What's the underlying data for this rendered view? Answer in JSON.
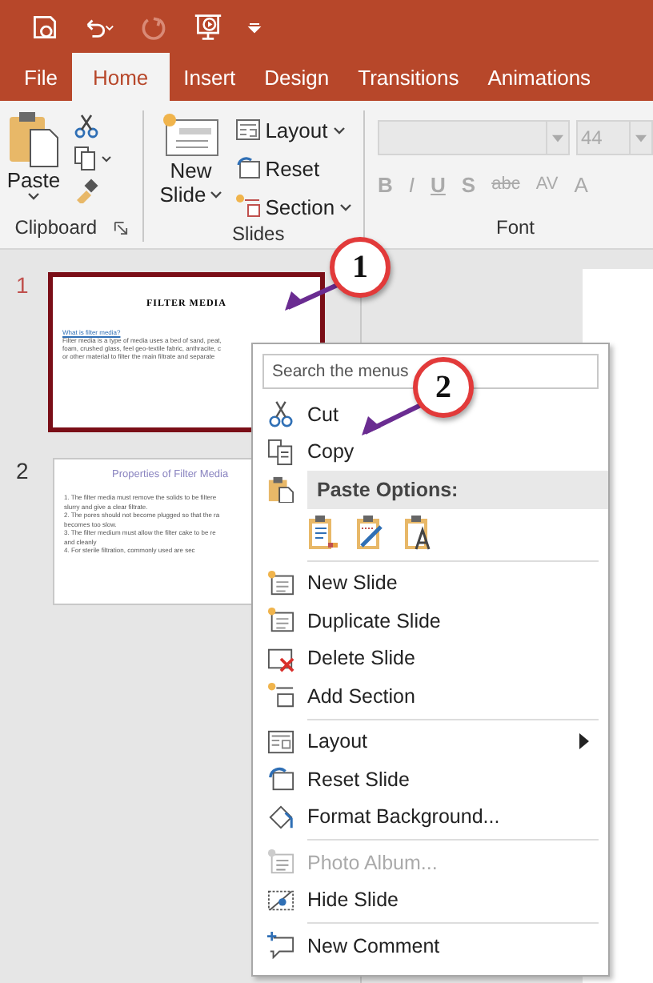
{
  "tabs": [
    {
      "label": "File",
      "selected": false
    },
    {
      "label": "Home",
      "selected": true
    },
    {
      "label": "Insert",
      "selected": false
    },
    {
      "label": "Design",
      "selected": false
    },
    {
      "label": "Transitions",
      "selected": false
    },
    {
      "label": "Animations",
      "selected": false
    }
  ],
  "ribbon": {
    "clipboard": {
      "paste": "Paste",
      "label": "Clipboard"
    },
    "slides": {
      "new_slide": [
        "New",
        "Slide"
      ],
      "layout": "Layout",
      "reset": "Reset",
      "section": "Section",
      "label": "Slides"
    },
    "font": {
      "size": "44",
      "disabled": true,
      "buttons": [
        "B",
        "I",
        "U",
        "S",
        "abc",
        "AV",
        "A"
      ],
      "label": "Font"
    }
  },
  "slides": [
    {
      "number": "1",
      "selected": true,
      "kind": "title",
      "title": "FILTER MEDIA",
      "link": "What is filter media?",
      "lines": [
        "Filter media is a type of media uses a bed of sand, peat,",
        "foam, crushed glass, feel geo-textile fabric, anthracite, c",
        "or other material to filter the main filtrate and separate"
      ]
    },
    {
      "number": "2",
      "selected": false,
      "kind": "list",
      "title": "Properties of Filter Media",
      "lines": [
        "1.  The filter media must remove the solids to be filtere",
        "     slurry and give a clear filtrate.",
        "2.  The pores should not become plugged so that the ra",
        "     becomes too slow.",
        "3.  The filter medium must allow the filter cake to be re",
        "     and cleanly",
        "4.  For sterile filtration, commonly used are sec"
      ]
    }
  ],
  "context_menu": {
    "search": {
      "placeholder": "Search the menus"
    },
    "items": [
      {
        "kind": "item",
        "label": "Cut",
        "disabled": false,
        "submenu": false,
        "separator_before": false
      },
      {
        "kind": "item",
        "label": "Copy",
        "disabled": false,
        "submenu": false,
        "separator_before": false
      },
      {
        "kind": "header",
        "label": "Paste Options:",
        "separator_before": false
      },
      {
        "kind": "paste_icons",
        "separator_before": false
      },
      {
        "kind": "item",
        "label": "New Slide",
        "disabled": false,
        "submenu": false,
        "separator_before": true
      },
      {
        "kind": "item",
        "label": "Duplicate Slide",
        "disabled": false,
        "submenu": false,
        "separator_before": false
      },
      {
        "kind": "item",
        "label": "Delete Slide",
        "disabled": false,
        "submenu": false,
        "separator_before": false
      },
      {
        "kind": "item",
        "label": "Add Section",
        "disabled": false,
        "submenu": false,
        "separator_before": false
      },
      {
        "kind": "item",
        "label": "Layout",
        "disabled": false,
        "submenu": true,
        "separator_before": true
      },
      {
        "kind": "item",
        "label": "Reset Slide",
        "disabled": false,
        "submenu": false,
        "separator_before": false
      },
      {
        "kind": "item",
        "label": "Format Background...",
        "disabled": false,
        "submenu": false,
        "separator_before": false
      },
      {
        "kind": "item",
        "label": "Photo Album...",
        "disabled": true,
        "submenu": false,
        "separator_before": true
      },
      {
        "kind": "item",
        "label": "Hide Slide",
        "disabled": false,
        "submenu": false,
        "separator_before": false
      },
      {
        "kind": "item",
        "label": "New Comment",
        "disabled": false,
        "submenu": false,
        "separator_before": true
      }
    ]
  },
  "callouts": [
    {
      "number": "1"
    },
    {
      "number": "2"
    }
  ]
}
